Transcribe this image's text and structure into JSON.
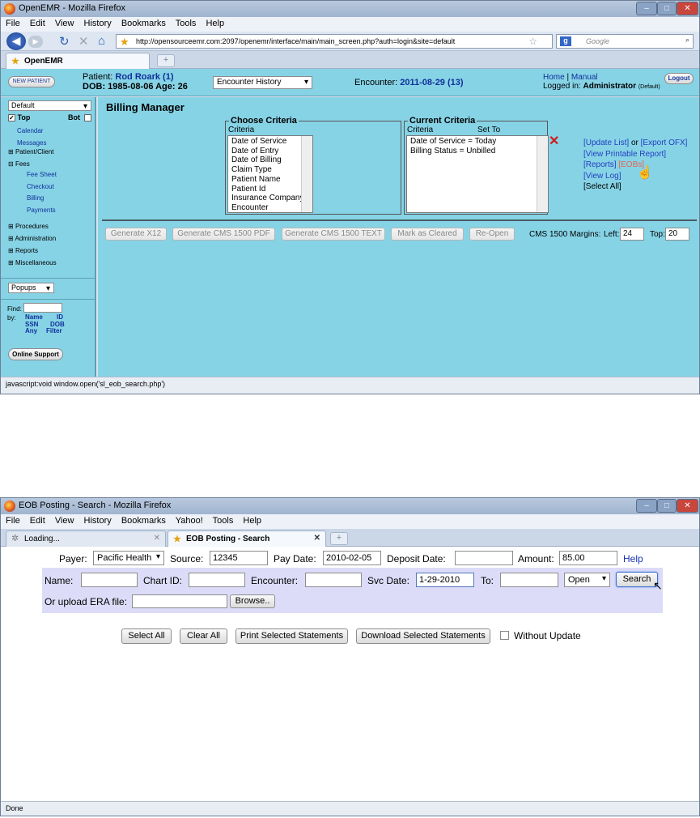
{
  "top": {
    "window_title": "OpenEMR - Mozilla Firefox",
    "menu": [
      "File",
      "Edit",
      "View",
      "History",
      "Bookmarks",
      "Tools",
      "Help"
    ],
    "url": "http://opensourceemr.com:2097/openemr/interface/main/main_screen.php?auth=login&site=default",
    "search_placeholder": "Google",
    "tab": "OpenEMR",
    "status": "javascript:void window.open('sl_eob_search.php')",
    "header": {
      "new_patient": "NEW PATIENT",
      "patient_label": "Patient:",
      "patient_name": "Rod Roark (1)",
      "dob_line": "DOB: 1985-08-06 Age: 26",
      "encounter_history": "Encounter History",
      "encounter_label": "Encounter:",
      "encounter_value": "2011-08-29 (13)",
      "home": "Home",
      "sep": "|",
      "manual": "Manual",
      "logged_in": "Logged in:",
      "user": "Administrator",
      "user_suffix": "(Default)",
      "logout": "Logout"
    },
    "sidebar": {
      "default_select": "Default",
      "top_label": "Top",
      "bot_label": "Bot",
      "items": [
        "Calendar",
        "Messages"
      ],
      "patient_client": "Patient/Client",
      "fees": "Fees",
      "fee_items": [
        "Fee Sheet",
        "Checkout",
        "Billing",
        "Payments"
      ],
      "groups": [
        "Procedures",
        "Administration",
        "Reports",
        "Miscellaneous"
      ],
      "popups": "Popups",
      "find": "Find:",
      "by": "by:",
      "find_links": [
        [
          "Name",
          "ID"
        ],
        [
          "SSN",
          "DOB"
        ],
        [
          "Any",
          "Filter"
        ]
      ],
      "online_support": "Online Support"
    },
    "billing": {
      "title": "Billing Manager",
      "choose_legend": "Choose Criteria",
      "criteria_header": "Criteria",
      "criteria_items": [
        "Date of Service",
        "Date of Entry",
        "Date of Billing",
        "Claim Type",
        "Patient Name",
        "Patient Id",
        "Insurance Company",
        "Encounter"
      ],
      "current_legend": "Current Criteria",
      "current_criteria_header": "Criteria",
      "current_setto_header": "Set To",
      "current_items": [
        "Date of Service = Today",
        "Billing Status = Unbilled"
      ],
      "links": {
        "update_list": "[Update List]",
        "or": "or",
        "export_ofx": "[Export OFX]",
        "printable": "[View Printable Report]",
        "reports": "[Reports]",
        "eobs": "[EOBs]",
        "view_log": "[View Log]",
        "select_all": "[Select All]"
      },
      "buttons": [
        "Generate X12",
        "Generate CMS 1500 PDF",
        "Generate CMS 1500 TEXT",
        "Mark as Cleared",
        "Re-Open"
      ],
      "margins_label": "CMS 1500 Margins:",
      "left_label": "Left:",
      "left_value": "24",
      "top_label": "Top:",
      "top_value": "20"
    }
  },
  "bottom": {
    "window_title": "EOB Posting - Search - Mozilla Firefox",
    "menu": [
      "File",
      "Edit",
      "View",
      "History",
      "Bookmarks",
      "Yahoo!",
      "Tools",
      "Help"
    ],
    "tab1": "Loading...",
    "tab2": "EOB Posting - Search",
    "status": "Done",
    "form": {
      "payer_label": "Payer:",
      "payer_value": "Pacific Health",
      "source_label": "Source:",
      "source_value": "12345",
      "pay_date_label": "Pay Date:",
      "pay_date_value": "2010-02-05",
      "deposit_label": "Deposit Date:",
      "deposit_value": "",
      "amount_label": "Amount:",
      "amount_value": "85.00",
      "help": "Help",
      "name_label": "Name:",
      "chart_label": "Chart ID:",
      "encounter_label": "Encounter:",
      "svc_label": "Svc Date:",
      "svc_value": "1-29-2010",
      "to_label": "To:",
      "open_value": "Open",
      "search": "Search",
      "era_label": "Or upload ERA file:",
      "browse": "Browse..",
      "select_all": "Select All",
      "clear_all": "Clear All",
      "print_selected": "Print Selected Statements",
      "download_selected": "Download Selected Statements",
      "without_update": "Without Update"
    }
  }
}
